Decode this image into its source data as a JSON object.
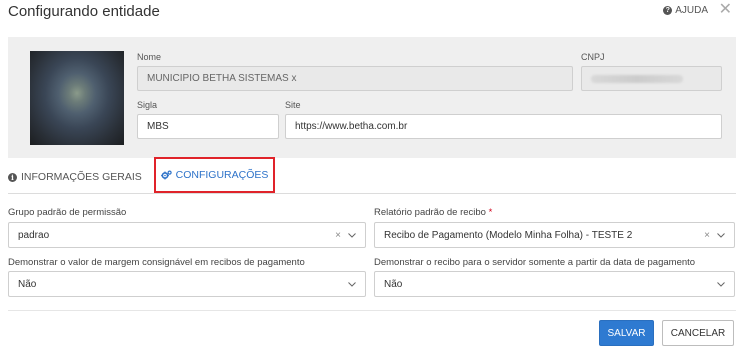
{
  "header": {
    "title": "Configurando entidade",
    "help_label": "AJUDA",
    "close_symbol": "✕"
  },
  "entity": {
    "nome_label": "Nome",
    "nome_value": "MUNICIPIO BETHA SISTEMAS x",
    "cnpj_label": "CNPJ",
    "sigla_label": "Sigla",
    "sigla_value": "MBS",
    "site_label": "Site",
    "site_value": "https://www.betha.com.br"
  },
  "tabs": {
    "general_label": "INFORMAÇÕES GERAIS",
    "config_label": "CONFIGURAÇÕES"
  },
  "config": {
    "grupo_label": "Grupo padrão de permissão",
    "grupo_value": "padrao",
    "relatorio_label": "Relatório padrão de recibo",
    "relatorio_required": "*",
    "relatorio_value": "Recibo de Pagamento (Modelo Minha Folha) - TESTE 2",
    "margem_label": "Demonstrar o valor de margem consignável em recibos de pagamento",
    "margem_value": "Não",
    "servidor_label": "Demonstrar o recibo para o servidor somente a partir da data de pagamento",
    "servidor_value": "Não",
    "clear_symbol": "×"
  },
  "footer": {
    "save_label": "SALVAR",
    "cancel_label": "CANCELAR"
  },
  "colors": {
    "primary": "#2e7ad1",
    "tab_active": "#2e73c9",
    "highlight_border": "#e0232a",
    "panel_bg": "#efefef"
  }
}
